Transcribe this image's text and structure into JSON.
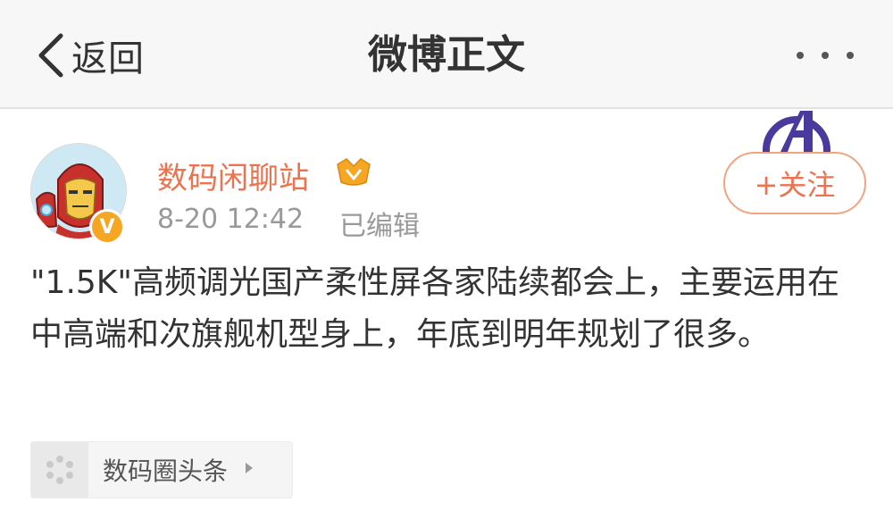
{
  "nav": {
    "back_label": "返回",
    "title": "微博正文"
  },
  "post": {
    "author": "数码闲聊站",
    "verified_mark": "V",
    "time": "8-20 12:42",
    "edited_label": "已编辑",
    "follow_label": "+关注",
    "text": "\"1.5K\"高频调光国产柔性屏各家陆续都会上，主要运用在中高端和次旗舰机型身上，年底到明年规划了很多。",
    "topic_label": "数码圈头条"
  },
  "icons": {
    "back": "chevron-left-icon",
    "more": "more-dots-icon",
    "member": "member-crown-icon",
    "avengers": "avengers-logo-icon",
    "topic": "topic-pinwheel-icon",
    "topic_arrow": "triangle-right-icon"
  },
  "colors": {
    "accent": "#eb7350",
    "badge": "#f5a623",
    "navbar_bg": "#f7f7f7",
    "muted_text": "#999999"
  }
}
